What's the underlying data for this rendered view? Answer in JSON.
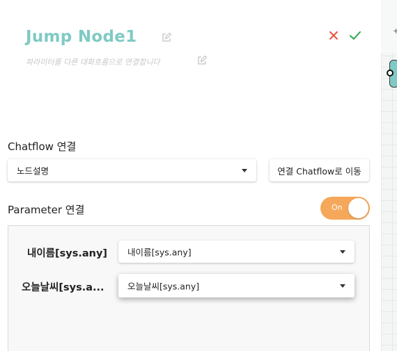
{
  "header": {
    "title": "Jump Node1",
    "description": "파라미터를 다른 대화흐름으로 연결합니다"
  },
  "chatflow": {
    "label": "Chatflow 연결",
    "selected": "노드설명",
    "move_button": "연결 Chatflow로 이동"
  },
  "parameter": {
    "label": "Parameter 연결",
    "toggle_label": "On",
    "rows": [
      {
        "name": "내이름[sys.any]",
        "value": "내이름[sys.any]"
      },
      {
        "name": "오늘날씨[sys.a...",
        "value": "오늘날씨[sys.any]"
      }
    ]
  },
  "colors": {
    "title": "#7fcac4",
    "cancel": "#e8553b",
    "confirm": "#2aa84a",
    "toggle_on": "#f5a85a"
  },
  "icons": [
    "edit-icon",
    "close-icon",
    "check-icon",
    "dropdown-arrow-icon"
  ]
}
